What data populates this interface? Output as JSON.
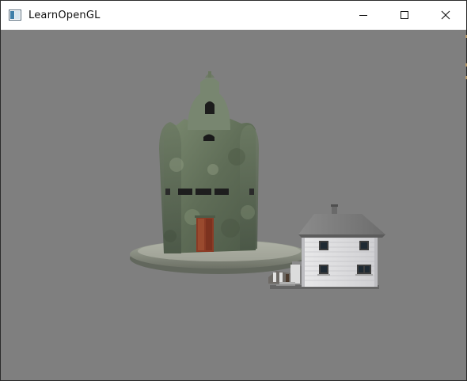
{
  "window": {
    "title": "LearnOpenGL",
    "buttons": {
      "minimize": "minimize",
      "maximize": "maximize",
      "close": "close"
    }
  },
  "scene": {
    "clear_color": "#7f7f7f",
    "objects": [
      "castle-model",
      "house-model"
    ]
  }
}
